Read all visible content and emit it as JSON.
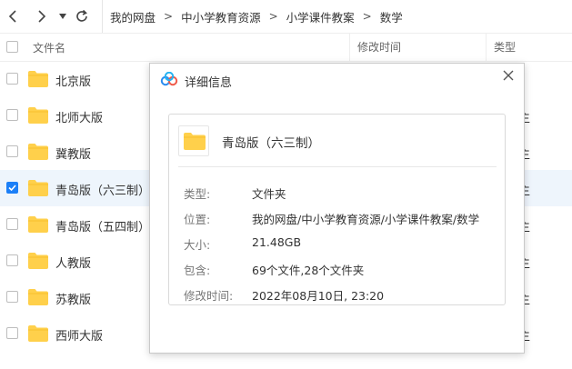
{
  "nav": {
    "back_icon": "chevron-left",
    "forward_icon": "chevron-right",
    "history_icon": "caret-down",
    "refresh_icon": "refresh"
  },
  "breadcrumb": [
    "我的网盘",
    "中小学教育资源",
    "小学课件教案",
    "数学"
  ],
  "breadcrumb_sep": ">",
  "columns": {
    "name": "文件名",
    "modified": "修改时间",
    "type": "类型"
  },
  "rows": [
    {
      "name": "北京版",
      "type_tail": "",
      "selected": false
    },
    {
      "name": "北师大版",
      "type_tail": "主",
      "selected": false
    },
    {
      "name": "冀教版",
      "type_tail": "主",
      "selected": false
    },
    {
      "name": "青岛版（六三制）",
      "type_tail": "主",
      "selected": true
    },
    {
      "name": "青岛版（五四制）",
      "type_tail": "主",
      "selected": false
    },
    {
      "name": "人教版",
      "type_tail": "主",
      "selected": false
    },
    {
      "name": "苏教版",
      "type_tail": "主",
      "selected": false
    },
    {
      "name": "西师大版",
      "type_tail": "主",
      "selected": false
    }
  ],
  "dialog": {
    "title": "详细信息",
    "folder_name": "青岛版（六三制）",
    "fields": [
      {
        "label": "类型:",
        "value": "文件夹"
      },
      {
        "label": "位置:",
        "value": "我的网盘/中小学教育资源/小学课件教案/数学"
      },
      {
        "label": "大小:",
        "value": "21.48GB"
      },
      {
        "label": "包含:",
        "value": "69个文件,28个文件夹"
      },
      {
        "label": "修改时间:",
        "value": "2022年08月10日, 23:20"
      }
    ]
  },
  "colors": {
    "folder": "#ffd04b",
    "accent": "#1b7ff7",
    "selected_row": "#eef5fc"
  }
}
